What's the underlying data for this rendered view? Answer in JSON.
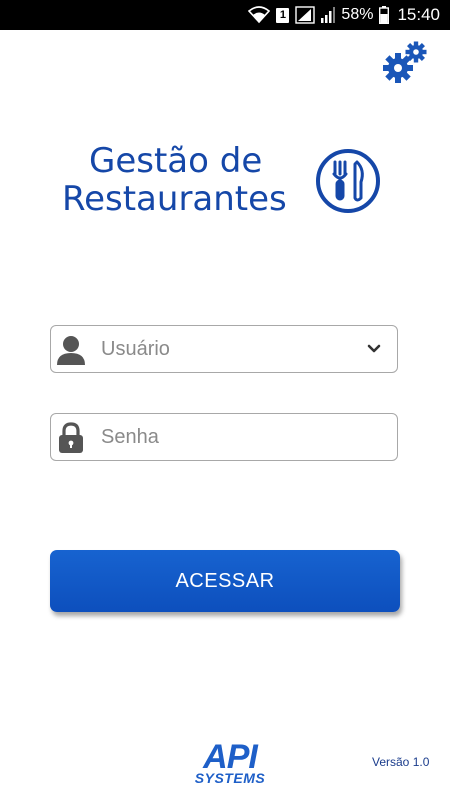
{
  "status_bar": {
    "sim_badge": "1",
    "battery": "58%",
    "time": "15:40"
  },
  "header": {
    "settings_icon": "gears-icon"
  },
  "logo": {
    "line1": "Gestão de",
    "line2": "Restaurantes",
    "icon": "fork-knife-plate-icon",
    "color": "#1547a8"
  },
  "login_form": {
    "user_placeholder": "Usuário",
    "password_placeholder": "Senha",
    "submit_label": "ACESSAR"
  },
  "footer": {
    "brand_top": "API",
    "brand_bottom": "SYSTEMS",
    "version": "Versão 1.0"
  },
  "colors": {
    "primary": "#0d56c6",
    "brand": "#1547a8"
  }
}
